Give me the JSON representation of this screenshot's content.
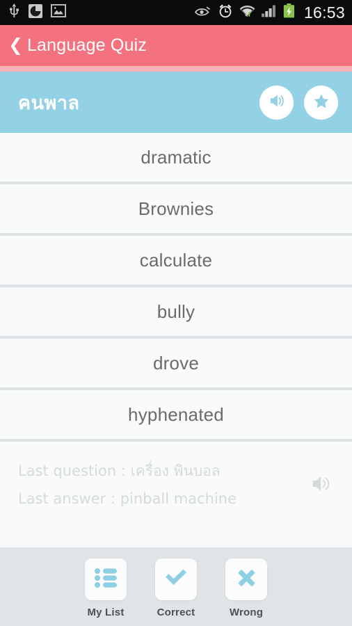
{
  "status_bar": {
    "time": "16:53",
    "left_icons": [
      "usb-icon",
      "sd-card-icon",
      "screenshot-image-icon"
    ],
    "right_icons": [
      "eye-smart-stay-icon",
      "alarm-clock-icon",
      "wifi-icon",
      "cellular-signal-icon",
      "battery-charging-icon"
    ],
    "background_color": "#0B0B0B"
  },
  "app_bar": {
    "back_label": "❮",
    "title": "Language Quiz",
    "background_color": "#F4717F",
    "underline_color": "#FAB3BB"
  },
  "question_bar": {
    "word": "คนพาล",
    "background_color": "#93D1E4",
    "speak_button": "speaker-icon",
    "favorite_button": "star-icon"
  },
  "answers": [
    {
      "label": "dramatic"
    },
    {
      "label": "Brownies"
    },
    {
      "label": "calculate"
    },
    {
      "label": "bully"
    },
    {
      "label": "drove"
    },
    {
      "label": "hyphenated"
    }
  ],
  "last_block": {
    "question_line": "Last question : เครื่อง พินบอล",
    "answer_line": "Last answer : pinball machine",
    "speaker_icon": "speaker-icon",
    "text_color": "#D6DADC"
  },
  "bottom_bar": {
    "background_color": "#DFE4E7",
    "accent_color": "#8DCFE3",
    "items": [
      {
        "label": "My List",
        "icon": "list-icon"
      },
      {
        "label": "Correct",
        "icon": "check-icon"
      },
      {
        "label": "Wrong",
        "icon": "cross-icon"
      }
    ]
  }
}
